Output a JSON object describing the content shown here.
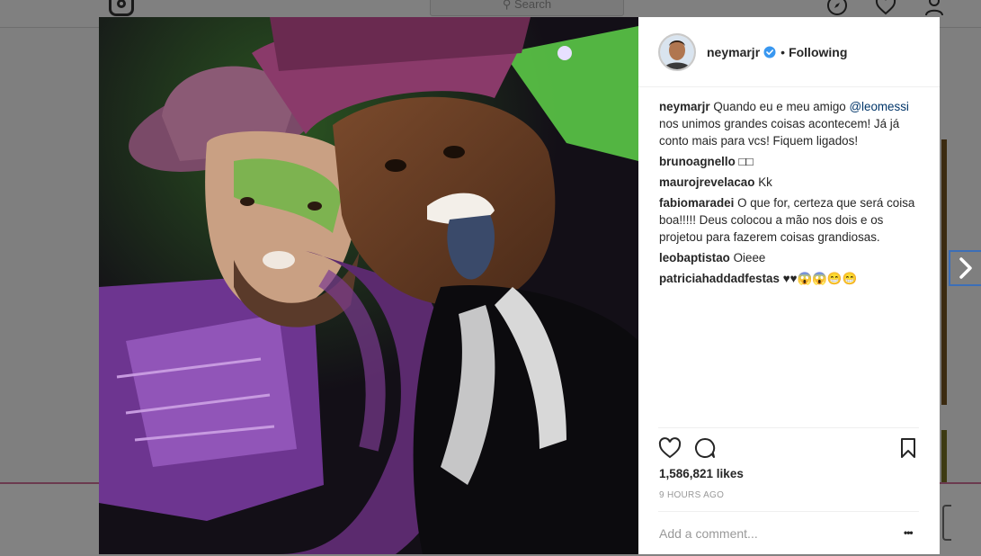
{
  "background": {
    "search_placeholder": "Search"
  },
  "post": {
    "username": "neymarjr",
    "separator": "•",
    "follow_status": "Following",
    "caption_user": "neymarjr",
    "caption_before": "Quando eu e meu amigo ",
    "caption_mention": "@leomessi",
    "caption_after": " nos unimos grandes coisas acontecem! Já já conto mais para vcs! Fiquem ligados!",
    "comments": [
      {
        "user": "brunoagnello",
        "text": "□□"
      },
      {
        "user": "maurojrevelacao",
        "text": "Kk"
      },
      {
        "user": "fabiomaradei",
        "text": "O que for, certeza que será coisa boa!!!!! Deus colocou a mão nos dois e os projetou para fazerem coisas grandiosas."
      },
      {
        "user": "leobaptistao",
        "text": "Oieee"
      },
      {
        "user": "patriciahaddadfestas",
        "text": "♥♥😱😱😁😁"
      }
    ],
    "likes": "1,586,821 likes",
    "time": "9 HOURS AGO",
    "comment_placeholder": "Add a comment...",
    "more_label": "•••"
  },
  "colors": {
    "accent_link": "#003569",
    "verified": "#3897f0",
    "overlay": "#7f7f7f"
  },
  "icons": [
    "instagram-logo-icon",
    "search-icon",
    "compass-icon",
    "heart-icon",
    "profile-icon",
    "verified-badge-icon",
    "like-heart-icon",
    "comment-icon",
    "bookmark-icon",
    "chevron-right-icon",
    "more-options-icon"
  ]
}
